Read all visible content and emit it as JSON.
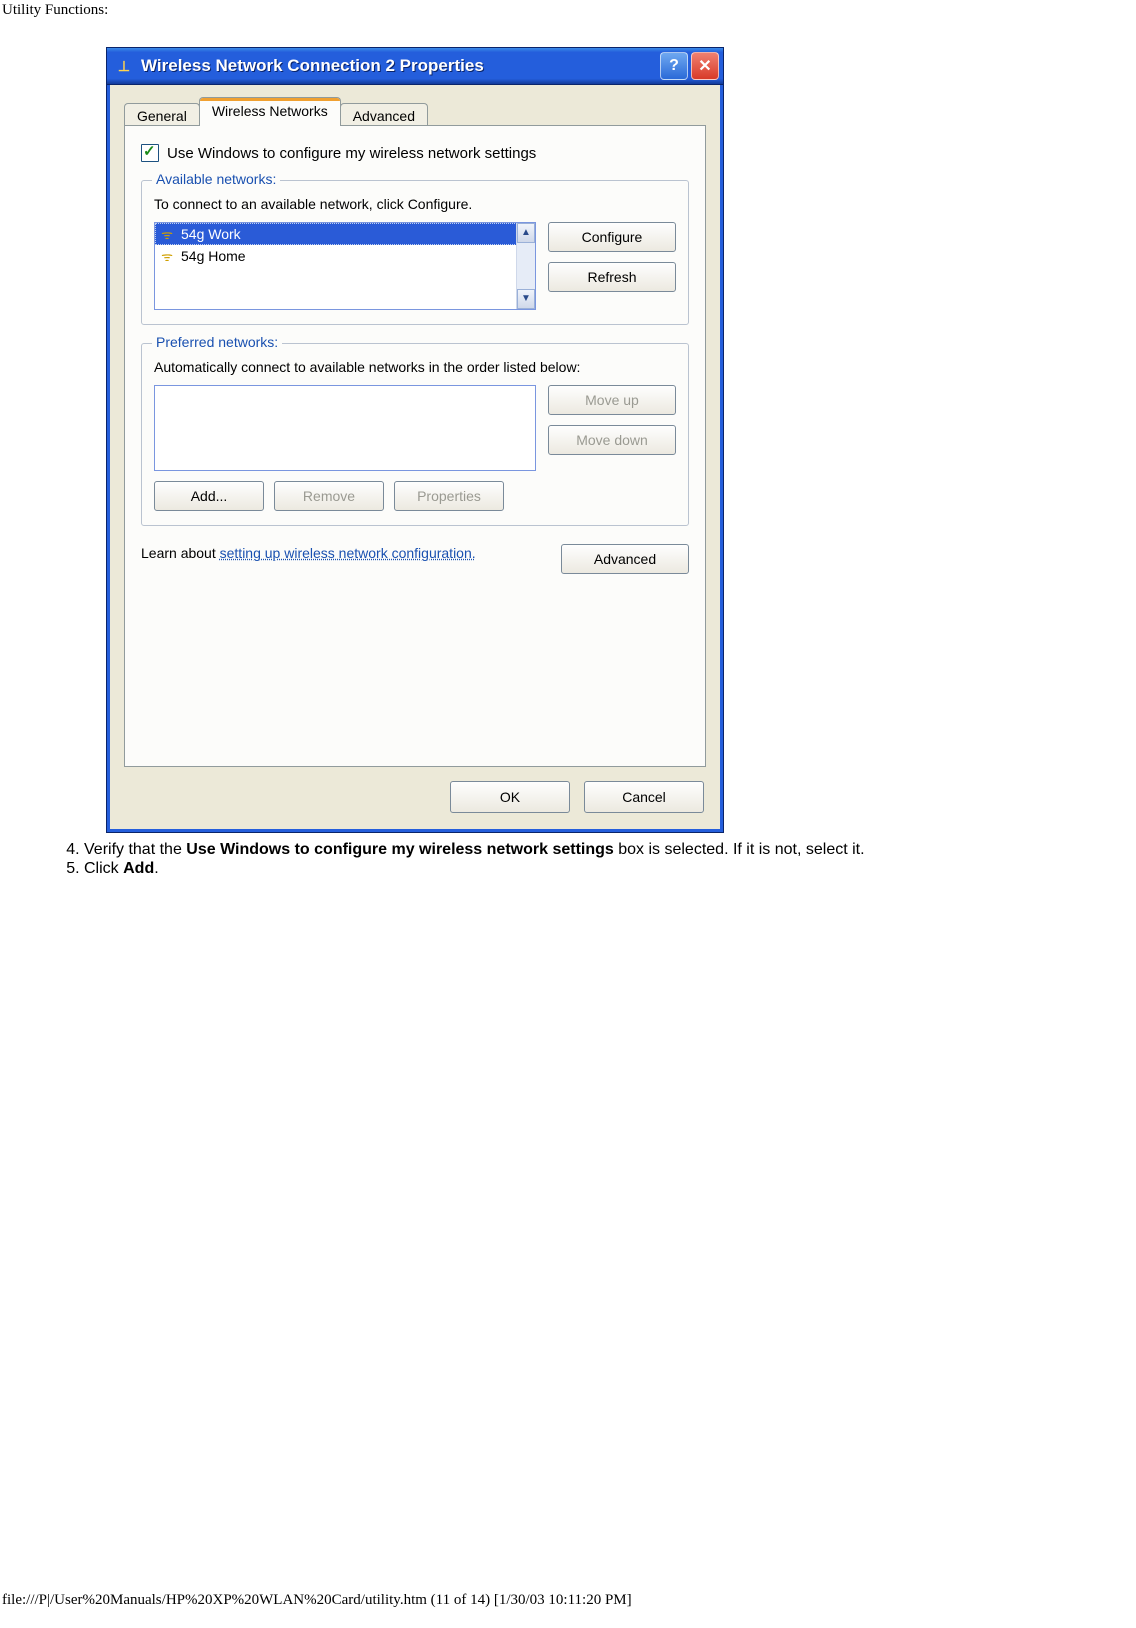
{
  "page_header": "Utility Functions:",
  "window": {
    "title": "Wireless Network Connection 2 Properties",
    "tabs": {
      "general": "General",
      "wireless": "Wireless Networks",
      "advanced": "Advanced"
    },
    "checkbox_label": "Use Windows to configure my wireless network settings",
    "available": {
      "legend": "Available networks:",
      "hint": "To connect to an available network, click Configure.",
      "items": [
        "54g Work",
        "54g Home"
      ],
      "configure": "Configure",
      "refresh": "Refresh"
    },
    "preferred": {
      "legend": "Preferred networks:",
      "hint": "Automatically connect to available networks in the order listed below:",
      "move_up": "Move up",
      "move_down": "Move down",
      "add": "Add...",
      "remove": "Remove",
      "properties": "Properties"
    },
    "learn_prefix": "Learn about ",
    "learn_link": "setting up wireless network configuration.",
    "advanced_btn": "Advanced",
    "ok": "OK",
    "cancel": "Cancel"
  },
  "instructions": {
    "item4_pre": "Verify that the ",
    "item4_bold": "Use Windows to configure my wireless network settings",
    "item4_post": " box is selected. If it is not, select it.",
    "item5_pre": "Click ",
    "item5_bold": "Add",
    "item5_post": "."
  },
  "footer": "file:///P|/User%20Manuals/HP%20XP%20WLAN%20Card/utility.htm (11 of 14) [1/30/03 10:11:20 PM]"
}
